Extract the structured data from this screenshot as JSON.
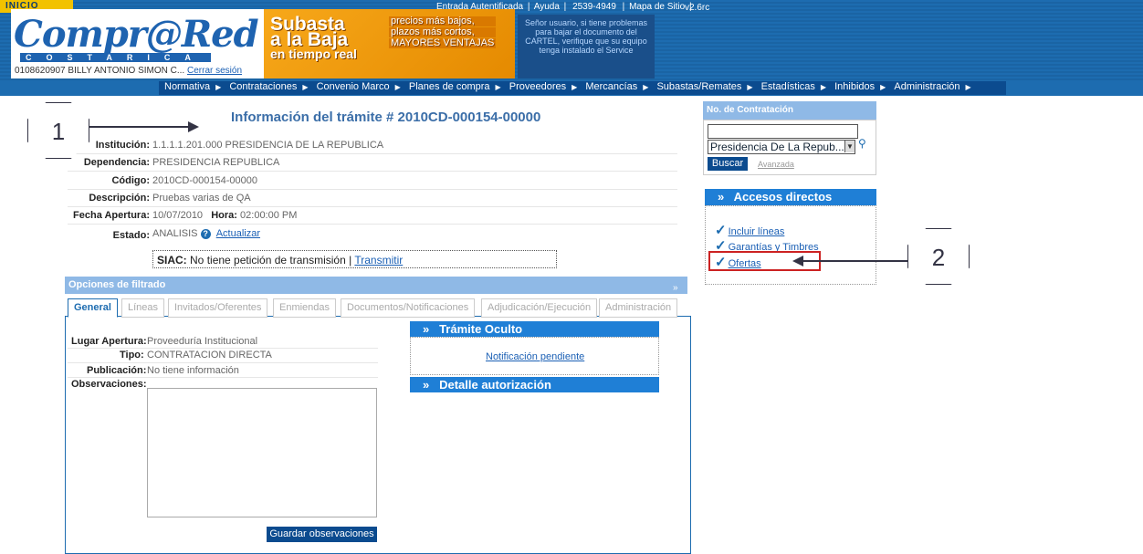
{
  "header": {
    "inicio": "INICIO",
    "top_links": [
      "Entrada Autentificada",
      "Ayuda",
      "2539-4949",
      "Mapa de Sitio"
    ],
    "version": "v2.6rc",
    "logo": "Compr@Red",
    "logo_sub": "COSTARICA",
    "user": "0108620907 BILLY ANTONIO SIMON C...",
    "logout": "Cerrar sesión",
    "banner_title": [
      "Subasta",
      "a la Baja",
      "en tiempo real"
    ],
    "banner_text": [
      "precios más bajos,",
      "plazos más cortos,",
      "MAYORES VENTAJAS"
    ],
    "notice": "Señor usuario, si tiene problemas para bajar el documento del CARTEL, verifique que su equipo tenga instalado el Service"
  },
  "nav": [
    "Normativa",
    "Contrataciones",
    "Convenio Marco",
    "Planes de compra",
    "Proveedores",
    "Mercancías",
    "Subastas/Remates",
    "Estadísticas",
    "Inhibidos",
    "Administración"
  ],
  "page_title": "Información del trámite # 2010CD-000154-00000",
  "details": {
    "institucion_label": "Institución:",
    "institucion": "1.1.1.1.201.000   PRESIDENCIA DE LA REPUBLICA",
    "dependencia_label": "Dependencia:",
    "dependencia": "PRESIDENCIA REPUBLICA",
    "codigo_label": "Código:",
    "codigo": "2010CD-000154-00000",
    "descripcion_label": "Descripción:",
    "descripcion": "Pruebas varias de QA",
    "fecha_label": "Fecha Apertura:",
    "fecha": "10/07/2010",
    "hora_label": "Hora:",
    "hora": "02:00:00 PM",
    "estado_label": "Estado:",
    "estado": "ANALISIS",
    "actualizar": "Actualizar"
  },
  "siac": {
    "label": "SIAC:",
    "text": "No tiene petición de transmisión |",
    "link": "Transmitir"
  },
  "filter": {
    "header": "Opciones de filtrado",
    "tabs": [
      "General",
      "Líneas",
      "Invitados/Oferentes",
      "Enmiendas",
      "Documentos/Notificaciones",
      "Adjudicación/Ejecución",
      "Administración"
    ]
  },
  "general": {
    "lugar_label": "Lugar Apertura:",
    "lugar": "Proveeduría Institucional",
    "tipo_label": "Tipo:",
    "tipo": "CONTRATACION DIRECTA",
    "publicacion_label": "Publicación:",
    "publicacion": "No tiene información",
    "obs_label": "Observaciones:",
    "save": "Guardar observaciones"
  },
  "tramite_oculto": {
    "title": "Trámite Oculto",
    "link": "Notificación pendiente"
  },
  "detalle": {
    "title": "Detalle autorización"
  },
  "no_contratacion": {
    "title": "No. de Contratación",
    "select": "Presidencia De La Repub...",
    "buscar": "Buscar",
    "avanzada": "Avanzada"
  },
  "accesos": {
    "title": "Accesos directos",
    "items": [
      "Incluir líneas",
      "Garantías y Timbres",
      "Ofertas"
    ]
  },
  "callouts": [
    "1",
    "2"
  ]
}
